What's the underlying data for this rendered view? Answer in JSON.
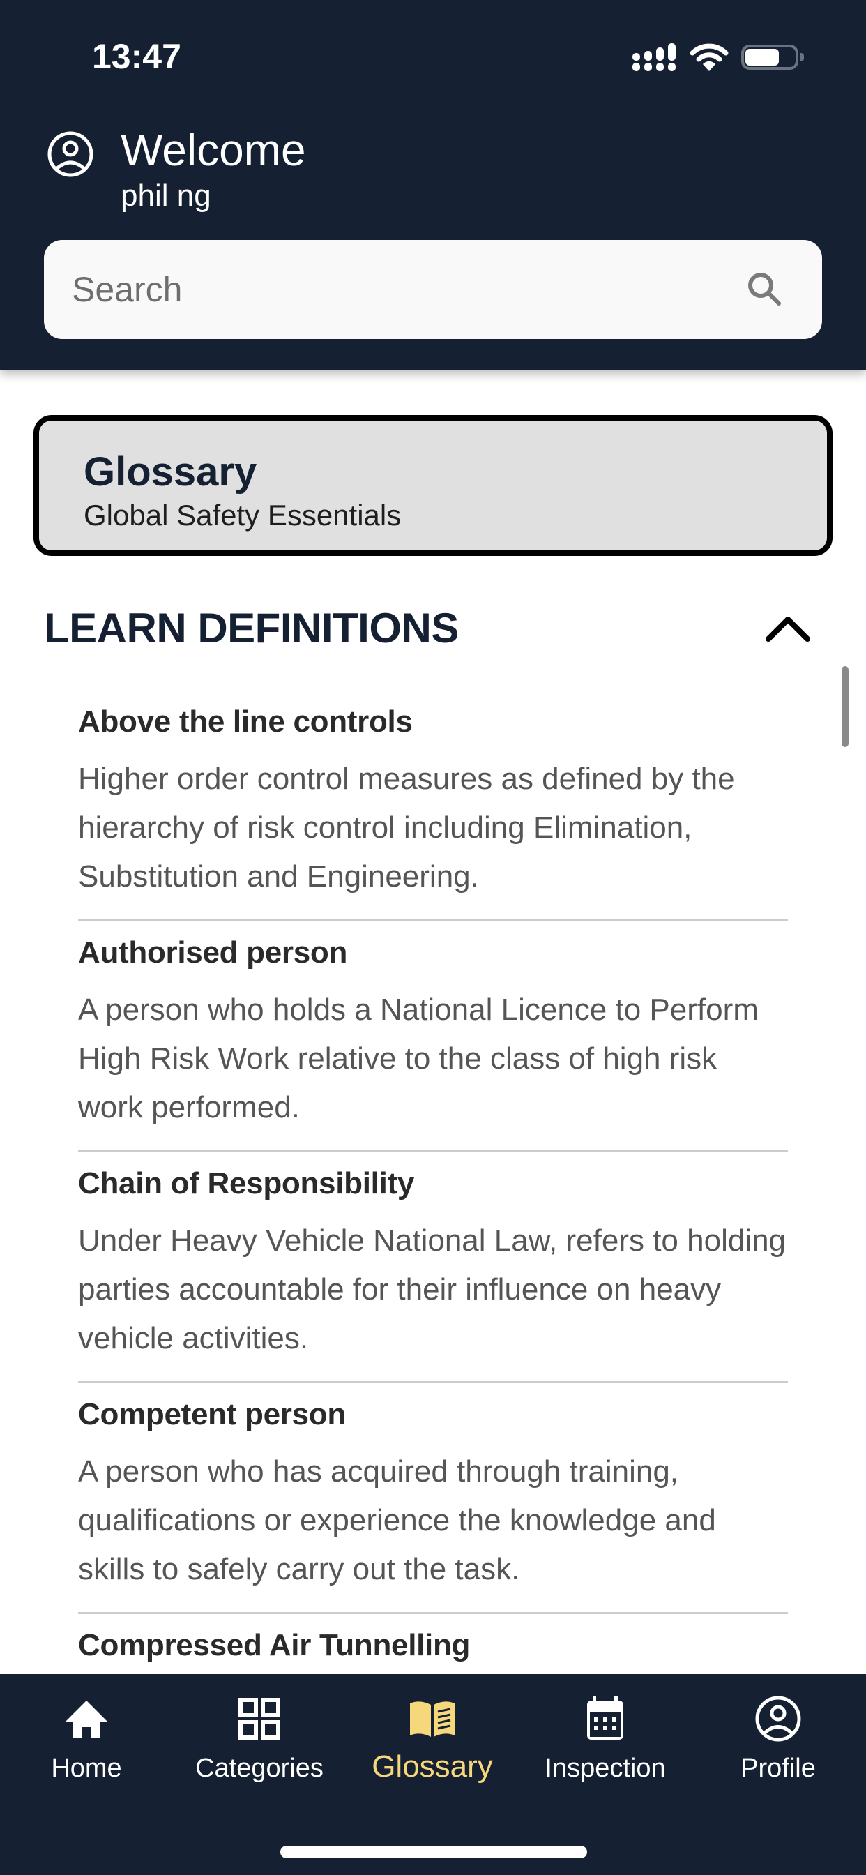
{
  "status_bar": {
    "time": "13:47",
    "icons": [
      "cellular-signal-icon",
      "wifi-icon",
      "battery-icon"
    ]
  },
  "header": {
    "welcome_label": "Welcome",
    "user_name": "phil ng",
    "avatar_icon": "user-circle-icon"
  },
  "search": {
    "placeholder": "Search",
    "value": "",
    "icon": "search-icon"
  },
  "glossary_card": {
    "title": "Glossary",
    "subtitle": "Global Safety Essentials"
  },
  "section": {
    "title": "LEARN DEFINITIONS",
    "expanded": true,
    "toggle_icon": "chevron-up-icon"
  },
  "definitions": [
    {
      "term": "Above the line controls",
      "definition": "Higher order control measures as defined by the hierarchy of risk control including Elimination, Substitution and Engineering."
    },
    {
      "term": "Authorised person",
      "definition": "A person who holds a National Licence to Perform High Risk Work relative to the class of high risk work performed."
    },
    {
      "term": "Chain of Responsibility",
      "definition": "Under Heavy Vehicle National Law, refers to holding parties accountable for their influence on heavy vehicle activities."
    },
    {
      "term": "Competent person",
      "definition": "A person who has acquired through training, qualifications or experience the knowledge and skills to safely carry out the task."
    },
    {
      "term": "Compressed Air Tunnelling",
      "definition": ""
    }
  ],
  "bottom_nav": {
    "active": "Glossary",
    "items": [
      {
        "label": "Home",
        "icon": "home-icon"
      },
      {
        "label": "Categories",
        "icon": "grid-icon"
      },
      {
        "label": "Glossary",
        "icon": "book-open-icon"
      },
      {
        "label": "Inspection",
        "icon": "calendar-icon"
      },
      {
        "label": "Profile",
        "icon": "user-circle-icon"
      }
    ]
  },
  "colors": {
    "header_bg": "#152032",
    "accent_active": "#f7d77c",
    "card_bg": "#e0e0e0",
    "card_border": "#000000",
    "title_text": "#152032",
    "definition_text": "#555555",
    "divider": "#cccccc"
  }
}
